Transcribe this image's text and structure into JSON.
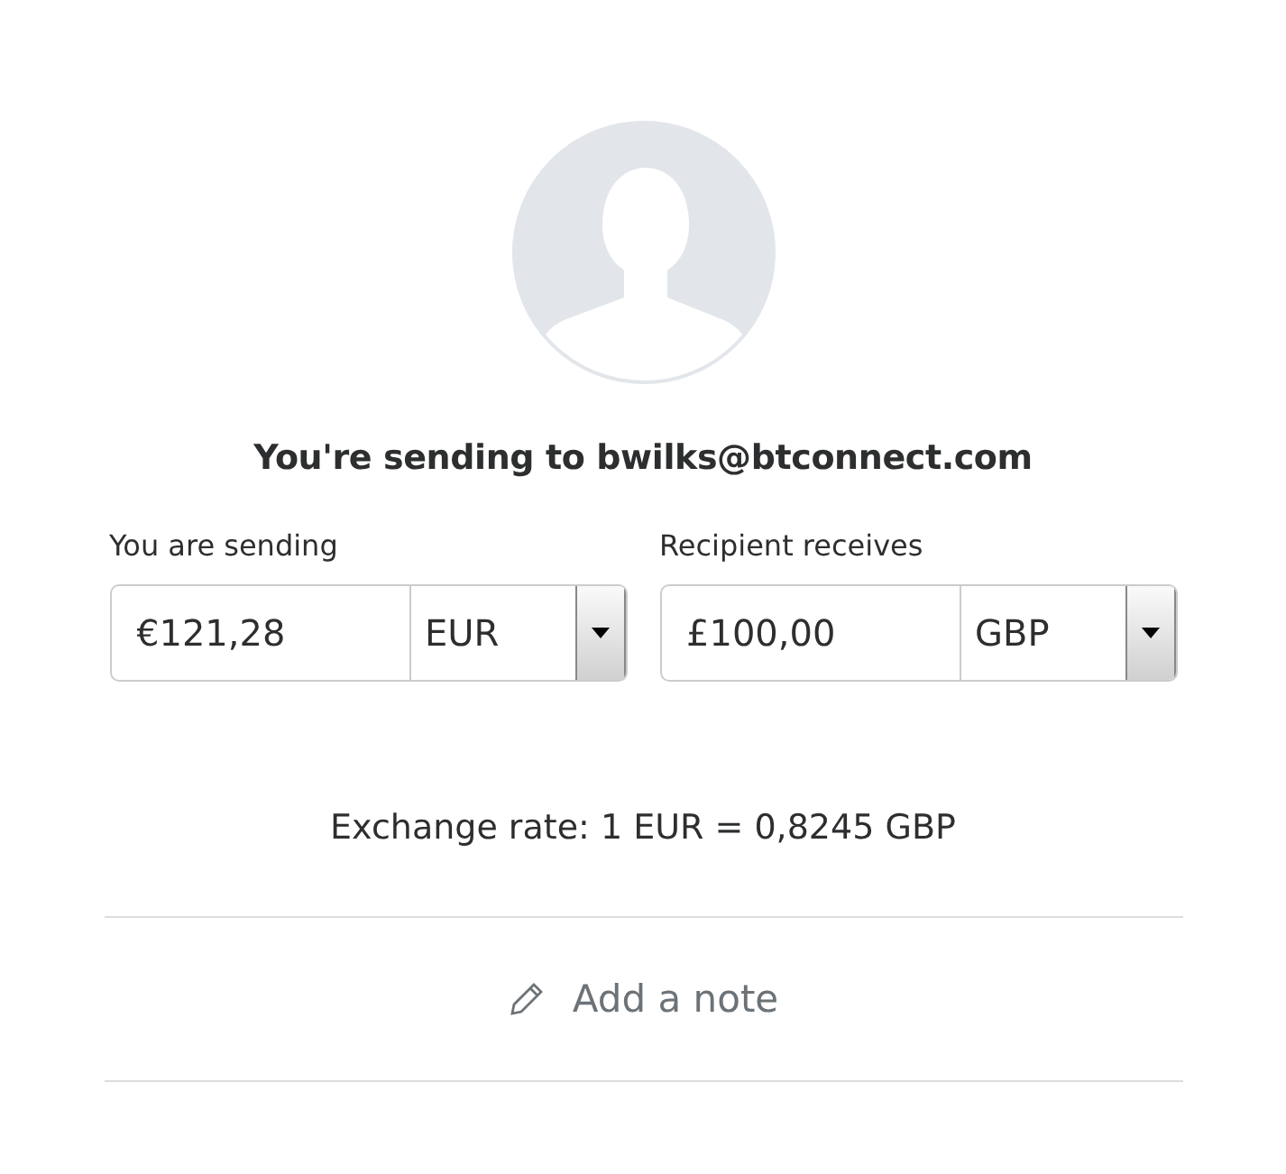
{
  "recipient": {
    "title": "You're sending to bwilks@btconnect.com"
  },
  "amounts": [
    {
      "label": "You are sending",
      "value": "€121,28",
      "currency": "EUR"
    },
    {
      "label": "Recipient receives",
      "value": "£100,00",
      "currency": "GBP"
    }
  ],
  "exchange_rate": "Exchange rate: 1 EUR = 0,8245 GBP",
  "note": {
    "label": "Add a note"
  }
}
